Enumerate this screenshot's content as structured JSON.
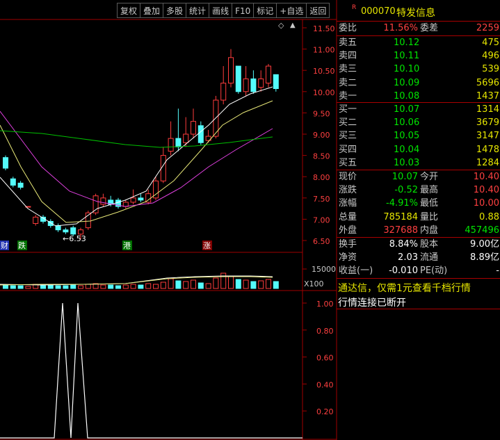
{
  "toolbar": {
    "buttons": [
      "复权",
      "叠加",
      "多股",
      "统计",
      "画线",
      "F10",
      "标记",
      "+自选",
      "返回"
    ]
  },
  "stock": {
    "flag": "R",
    "code": "000070",
    "name": "特发信息"
  },
  "order_ratio": {
    "label_left": "委比",
    "value_left": "11.56%",
    "label_right": "委差",
    "value_right": "2259"
  },
  "asks": [
    {
      "label": "卖五",
      "price": "10.12",
      "volume": "475"
    },
    {
      "label": "卖四",
      "price": "10.11",
      "volume": "496"
    },
    {
      "label": "卖三",
      "price": "10.10",
      "volume": "539"
    },
    {
      "label": "卖二",
      "price": "10.09",
      "volume": "5696"
    },
    {
      "label": "卖一",
      "price": "10.08",
      "volume": "1437"
    }
  ],
  "bids": [
    {
      "label": "买一",
      "price": "10.07",
      "volume": "1314"
    },
    {
      "label": "买二",
      "price": "10.06",
      "volume": "3679"
    },
    {
      "label": "买三",
      "price": "10.05",
      "volume": "3147"
    },
    {
      "label": "买四",
      "price": "10.04",
      "volume": "1478"
    },
    {
      "label": "买五",
      "price": "10.03",
      "volume": "1284"
    }
  ],
  "quote": [
    {
      "l1": "现价",
      "v1": "10.07",
      "c1": "#00e600",
      "l2": "今开",
      "v2": "10.40",
      "c2": "#ff4040"
    },
    {
      "l1": "涨跌",
      "v1": "-0.52",
      "c1": "#00e600",
      "l2": "最高",
      "v2": "10.40",
      "c2": "#ff4040"
    },
    {
      "l1": "涨幅",
      "v1": "-4.91%",
      "c1": "#00e600",
      "l2": "最低",
      "v2": "10.00",
      "c2": "#ff4040"
    },
    {
      "l1": "总量",
      "v1": "785184",
      "c1": "#e6e600",
      "l2": "量比",
      "v2": "0.88",
      "c2": "#e6e600"
    },
    {
      "l1": "外盘",
      "v1": "327688",
      "c1": "#ff4040",
      "l2": "内盘",
      "v2": "457496",
      "c2": "#00e600"
    }
  ],
  "finance": [
    {
      "l1": "换手",
      "v1": "8.84%",
      "l2": "股本",
      "v2": "9.00亿"
    },
    {
      "l1": "净资",
      "v1": "2.03",
      "l2": "流通",
      "v2": "8.89亿"
    },
    {
      "l1": "收益(一)",
      "v1": "-0.010",
      "l2": "PE(动)",
      "v2": "-"
    }
  ],
  "promo": {
    "ad": "通达信，仅需1元查看千档行情",
    "status": "行情连接已断开"
  },
  "chart_labels": {
    "price_axis": [
      "11.50",
      "11.00",
      "10.50",
      "10.00",
      "9.50",
      "9.00",
      "8.50",
      "8.00",
      "7.50",
      "7.00",
      "6.50"
    ],
    "volume_axis": [
      "15000"
    ],
    "volume_unit": "X100",
    "indicator_axis": [
      "1.00",
      "0.80",
      "0.60",
      "0.40",
      "0.20"
    ],
    "low_marker": "6.53",
    "news_tags": [
      "财",
      "跌",
      "港",
      "涨"
    ]
  },
  "colors": {
    "up": "#ff3c3c",
    "down": "#54fcfc",
    "ma5": "#ffffff",
    "ma10": "#e8e878",
    "ma20": "#e040e0",
    "ma60": "#00c000",
    "frame": "#a00000"
  }
}
